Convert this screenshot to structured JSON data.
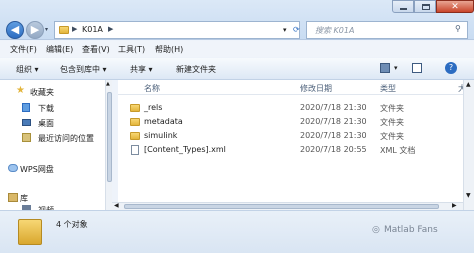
{
  "nav": {
    "back_icon": "back-arrow-icon",
    "forward_icon": "forward-arrow-icon"
  },
  "address": {
    "separator": "▶",
    "current_folder": "K01A"
  },
  "search": {
    "placeholder": "搜索 K01A"
  },
  "menu": [
    "文件(F)",
    "编辑(E)",
    "查看(V)",
    "工具(T)",
    "帮助(H)"
  ],
  "toolbar": {
    "organize": "组织 ▾",
    "include_in_library": "包含到库中 ▾",
    "share": "共享 ▾",
    "new_folder": "新建文件夹"
  },
  "sidebar": {
    "favorites": "收藏夹",
    "items": [
      "下载",
      "桌面",
      "最近访问的位置"
    ],
    "wps": "WPS网盘",
    "library": "库",
    "video": "视频"
  },
  "columns": {
    "name": "名称",
    "date": "修改日期",
    "type": "类型",
    "size": "大"
  },
  "files": [
    {
      "name": "_rels",
      "date": "2020/7/18 21:30",
      "type": "文件夹",
      "icon": "folder"
    },
    {
      "name": "metadata",
      "date": "2020/7/18 21:30",
      "type": "文件夹",
      "icon": "folder"
    },
    {
      "name": "simulink",
      "date": "2020/7/18 21:30",
      "type": "文件夹",
      "icon": "folder"
    },
    {
      "name": "[Content_Types].xml",
      "date": "2020/7/18 20:55",
      "type": "XML 文档",
      "icon": "xml-file"
    }
  ],
  "status": {
    "count": "4 个对象"
  },
  "watermark": "Matlab Fans"
}
